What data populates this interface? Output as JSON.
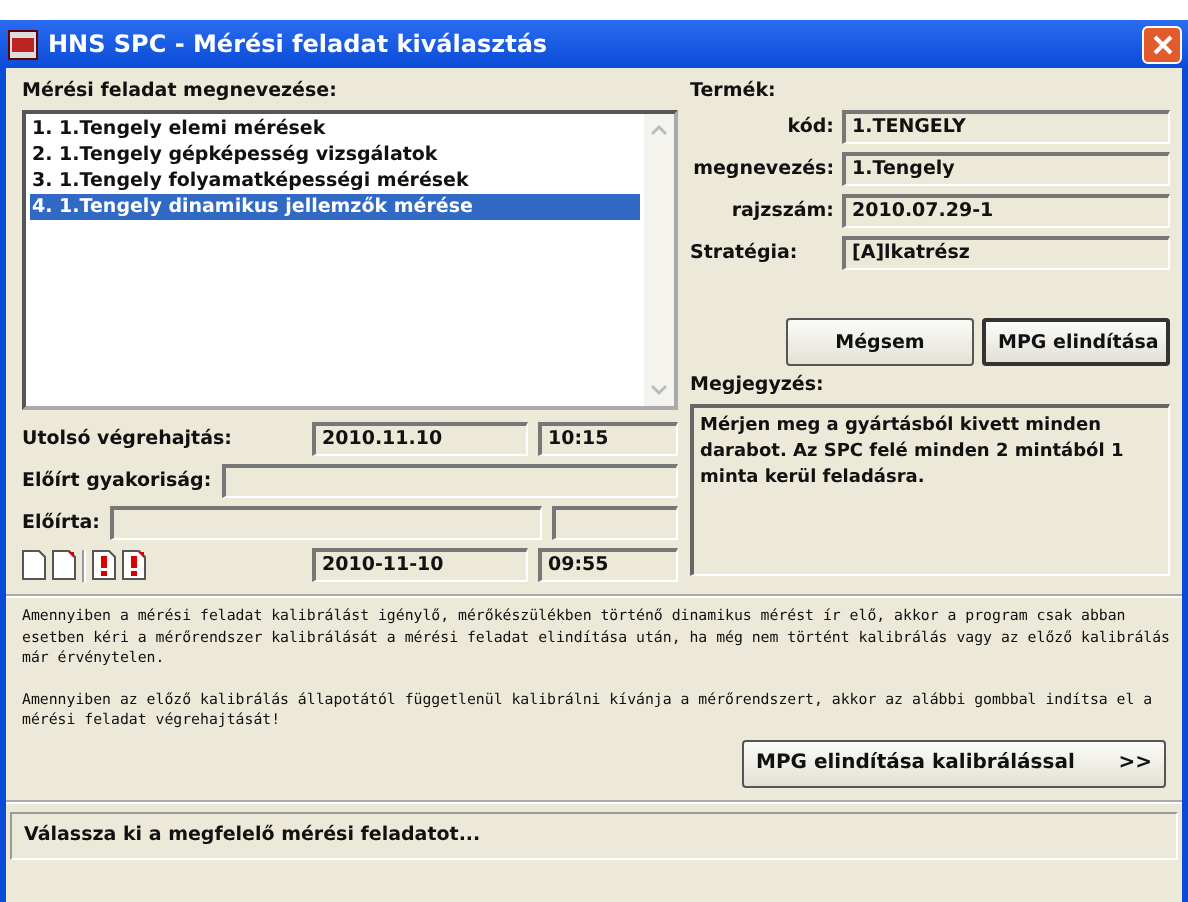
{
  "window": {
    "title": "HNS SPC - Mérési feladat kiválasztás"
  },
  "task_list": {
    "label": "Mérési feladat megnevezése:",
    "items": [
      {
        "number": "1.",
        "name": "1.Tengely elemi mérések",
        "selected": false
      },
      {
        "number": "2.",
        "name": "1.Tengely gépképesség vizsgálatok",
        "selected": false
      },
      {
        "number": "3.",
        "name": "1.Tengely folyamatképességi mérések",
        "selected": false
      },
      {
        "number": "4.",
        "name": "1.Tengely dinamikus jellemzők mérése",
        "selected": true
      }
    ]
  },
  "last_execution": {
    "label": "Utolsó végrehajtás:",
    "date": "2010.11.10",
    "time": "10:15"
  },
  "frequency": {
    "label": "Előírt gyakoriság:"
  },
  "prescribed_by": {
    "label": "Előírta:"
  },
  "timestamp": {
    "date": "2010-11-10",
    "time": "09:55"
  },
  "product": {
    "label": "Termék:",
    "fields": [
      {
        "label": "kód:",
        "value": "1.TENGELY"
      },
      {
        "label": "megnevezés:",
        "value": "1.Tengely"
      },
      {
        "label": "rajzszám:",
        "value": "2010.07.29-1"
      },
      {
        "label": "Stratégia:",
        "value": "[A]lkatrész"
      }
    ]
  },
  "buttons": [
    "Mégsem",
    "MPG elindítása"
  ],
  "notes": {
    "label": "Megjegyzés:",
    "text": "Mérjen meg a gyártásból kivett minden darabot. Az SPC felé minden 2 mintából 1 minta kerül feladásra."
  },
  "info": [
    "Amennyiben a mérési feladat kalibrálást igénylő, mérőkészülékben történő dinamikus mérést ír elő, akkor a program csak abban esetben kéri a mérőrendszer kalibrálását a mérési feladat elindítása után, ha még nem történt kalibrálás vagy az előző kalibrálás már érvénytelen.",
    "Amennyiben az előző kalibrálás állapotától függetlenül kalibrálni kívánja a mérőrendszert, akkor az alábbi gombbal indítsa el a mérési feladat végrehajtását!"
  ],
  "calibrate_button": {
    "label": "MPG elindítása kalibrálással",
    "arrow": ">>"
  },
  "status_bar": "Válassza ki a megfelelő mérési feladatot..."
}
